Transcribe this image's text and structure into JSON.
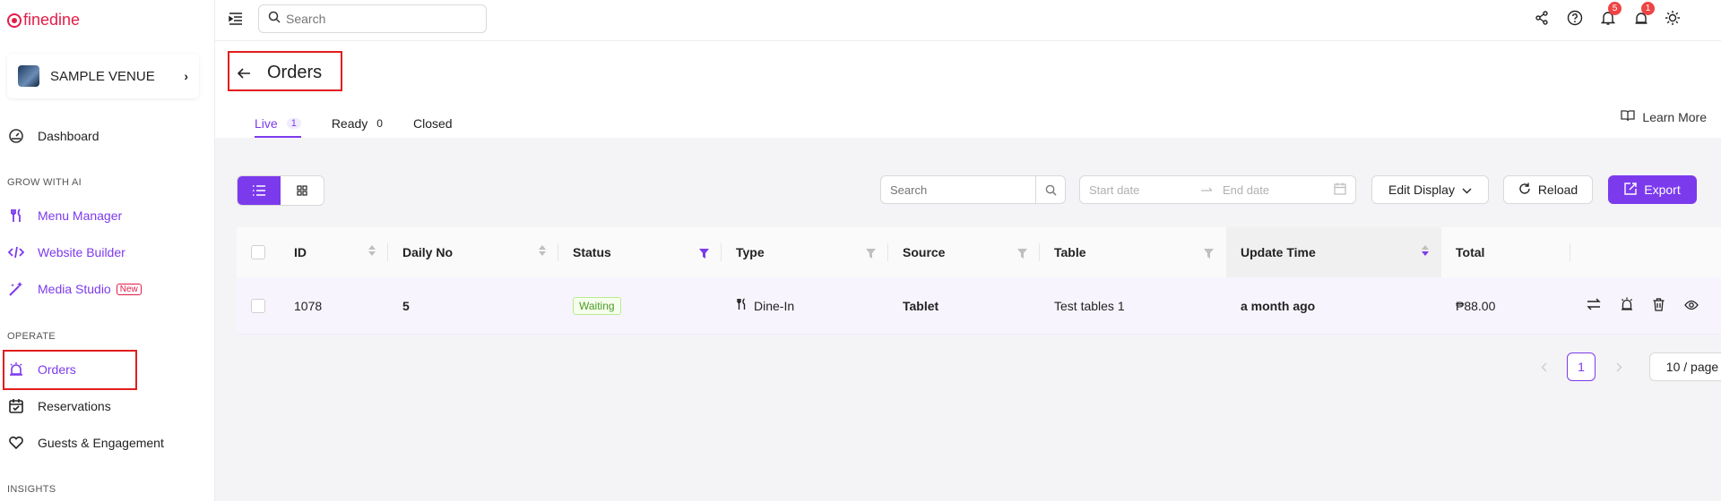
{
  "brand": {
    "name": "finedine",
    "color": "#e11d48"
  },
  "venue": {
    "name": "SAMPLE VENUE"
  },
  "sidebar": {
    "dashboard": "Dashboard",
    "section_grow": "GROW WITH AI",
    "menu_manager": "Menu Manager",
    "website_builder": "Website Builder",
    "media_studio": "Media Studio",
    "new_badge": "New",
    "section_operate": "OPERATE",
    "orders": "Orders",
    "reservations": "Reservations",
    "guests": "Guests & Engagement",
    "section_insights": "INSIGHTS"
  },
  "topbar": {
    "search_placeholder": "Search",
    "notifications_count": "5",
    "orders_count": "1"
  },
  "page": {
    "title": "Orders",
    "learn_more": "Learn More",
    "tabs": [
      {
        "label": "Live",
        "count": "1"
      },
      {
        "label": "Ready",
        "count": "0"
      },
      {
        "label": "Closed",
        "count": ""
      }
    ]
  },
  "toolbar": {
    "search_placeholder": "Search",
    "start_date": "Start date",
    "end_date": "End date",
    "edit_display": "Edit Display",
    "reload": "Reload",
    "export": "Export"
  },
  "table": {
    "columns": [
      "ID",
      "Daily No",
      "Status",
      "Type",
      "Source",
      "Table",
      "Update Time",
      "Total"
    ],
    "rows": [
      {
        "id": "1078",
        "daily_no": "5",
        "status": "Waiting",
        "type": "Dine-In",
        "source": "Tablet",
        "table": "Test tables 1",
        "update_time": "a month ago",
        "total": "₱88.00"
      }
    ]
  },
  "pagination": {
    "current": "1",
    "page_size": "10 / page"
  },
  "colors": {
    "accent": "#7c3aed",
    "highlight": "#e11d1d",
    "badge": "#ef4444"
  }
}
